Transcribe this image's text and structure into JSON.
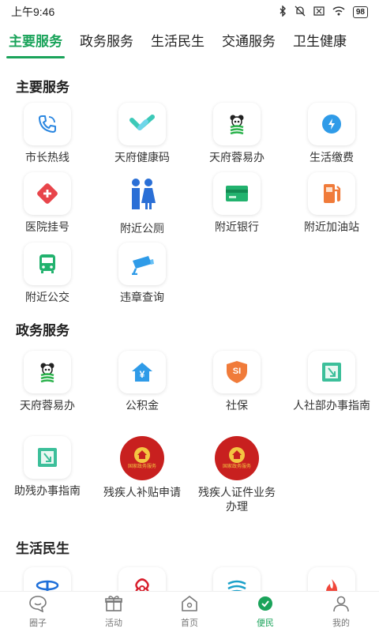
{
  "status": {
    "time": "上午9:46",
    "battery": "98"
  },
  "tabs": [
    "主要服务",
    "政务服务",
    "生活民生",
    "交通服务",
    "卫生健康"
  ],
  "sections": {
    "main": {
      "title": "主要服务",
      "items": [
        "市长热线",
        "天府健康码",
        "天府蓉易办",
        "生活缴费",
        "医院挂号",
        "附近公厕",
        "附近银行",
        "附近加油站",
        "附近公交",
        "违章查询"
      ]
    },
    "gov": {
      "title": "政务服务",
      "items": [
        "天府蓉易办",
        "公积金",
        "社保",
        "人社部办事指南",
        "助残办事指南",
        "残疾人补贴申请",
        "残疾人证件业务办理"
      ],
      "badge_text": "国家政务服务",
      "si_text": "SI",
      "yuan_text": "¥"
    },
    "life": {
      "title": "生活民生"
    }
  },
  "bottom_nav": [
    "圈子",
    "活动",
    "首页",
    "便民",
    "我的"
  ],
  "colors": {
    "accent": "#1aa35a"
  }
}
